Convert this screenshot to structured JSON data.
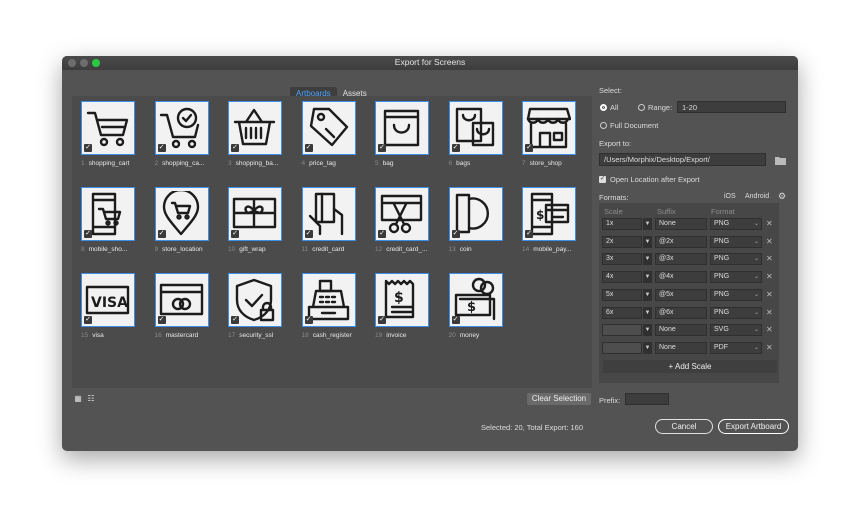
{
  "window": {
    "title": "Export for Screens"
  },
  "tabs": [
    {
      "label": "Artboards"
    },
    {
      "label": "Assets"
    }
  ],
  "artboards": [
    {
      "num": "1",
      "name": "shopping_cart",
      "icon": "shopping-cart-icon"
    },
    {
      "num": "2",
      "name": "shopping_ca...",
      "icon": "shopping-cart-check-icon"
    },
    {
      "num": "3",
      "name": "shopping_ba...",
      "icon": "shopping-basket-icon"
    },
    {
      "num": "4",
      "name": "price_tag",
      "icon": "price-tag-icon"
    },
    {
      "num": "5",
      "name": "bag",
      "icon": "bag-icon"
    },
    {
      "num": "6",
      "name": "bags",
      "icon": "bags-icon"
    },
    {
      "num": "7",
      "name": "store_shop",
      "icon": "store-shop-icon"
    },
    {
      "num": "8",
      "name": "mobile_sho...",
      "icon": "mobile-shopping-icon"
    },
    {
      "num": "9",
      "name": "store_location",
      "icon": "store-location-icon"
    },
    {
      "num": "10",
      "name": "gift_wrap",
      "icon": "gift-wrap-icon"
    },
    {
      "num": "11",
      "name": "credit_card",
      "icon": "credit-card-hand-icon"
    },
    {
      "num": "12",
      "name": "credit_card_...",
      "icon": "credit-card-cut-icon"
    },
    {
      "num": "13",
      "name": "coin",
      "icon": "coin-icon"
    },
    {
      "num": "14",
      "name": "mobile_pay...",
      "icon": "mobile-payment-icon"
    },
    {
      "num": "15",
      "name": "visa",
      "icon": "visa-icon"
    },
    {
      "num": "16",
      "name": "mastercard",
      "icon": "mastercard-icon"
    },
    {
      "num": "17",
      "name": "security_ssl",
      "icon": "security-ssl-icon"
    },
    {
      "num": "18",
      "name": "cash_register",
      "icon": "cash-register-icon"
    },
    {
      "num": "19",
      "name": "invoice",
      "icon": "invoice-icon"
    },
    {
      "num": "20",
      "name": "money",
      "icon": "money-icon"
    }
  ],
  "footer_left": {
    "clear_selection": "Clear Selection",
    "status": "Selected: 20, Total Export: 160"
  },
  "right": {
    "select_label": "Select:",
    "all_label": "All",
    "range_label": "Range:",
    "range_value": "1-20",
    "full_document_label": "Full Document",
    "export_to_label": "Export to:",
    "export_path": "/Users/Morphix/Desktop/Export/",
    "open_location_label": "Open Location after Export",
    "formats_label": "Formats:",
    "ios_label": "iOS",
    "android_label": "Android",
    "col_scale": "Scale",
    "col_suffix": "Suffix",
    "col_format": "Format",
    "add_scale": "+ Add Scale",
    "prefix_label": "Prefix:",
    "cancel": "Cancel",
    "export_artboard": "Export Artboard"
  },
  "formats": [
    {
      "scale": "1x",
      "suffix": "",
      "suffix_placeholder": "None",
      "format": "PNG"
    },
    {
      "scale": "2x",
      "suffix": "@2x",
      "suffix_placeholder": "",
      "format": "PNG"
    },
    {
      "scale": "3x",
      "suffix": "@3x",
      "suffix_placeholder": "",
      "format": "PNG"
    },
    {
      "scale": "4x",
      "suffix": "@4x",
      "suffix_placeholder": "",
      "format": "PNG"
    },
    {
      "scale": "5x",
      "suffix": "@5x",
      "suffix_placeholder": "",
      "format": "PNG"
    },
    {
      "scale": "6x",
      "suffix": "@6x",
      "suffix_placeholder": "",
      "format": "PNG"
    },
    {
      "scale": "",
      "suffix": "",
      "suffix_placeholder": "None",
      "format": "SVG"
    },
    {
      "scale": "",
      "suffix": "",
      "suffix_placeholder": "None",
      "format": "PDF"
    }
  ],
  "colors": {
    "accent": "#3b8eea",
    "tab_active": "#4aa3ff",
    "window_bg": "#535353"
  }
}
